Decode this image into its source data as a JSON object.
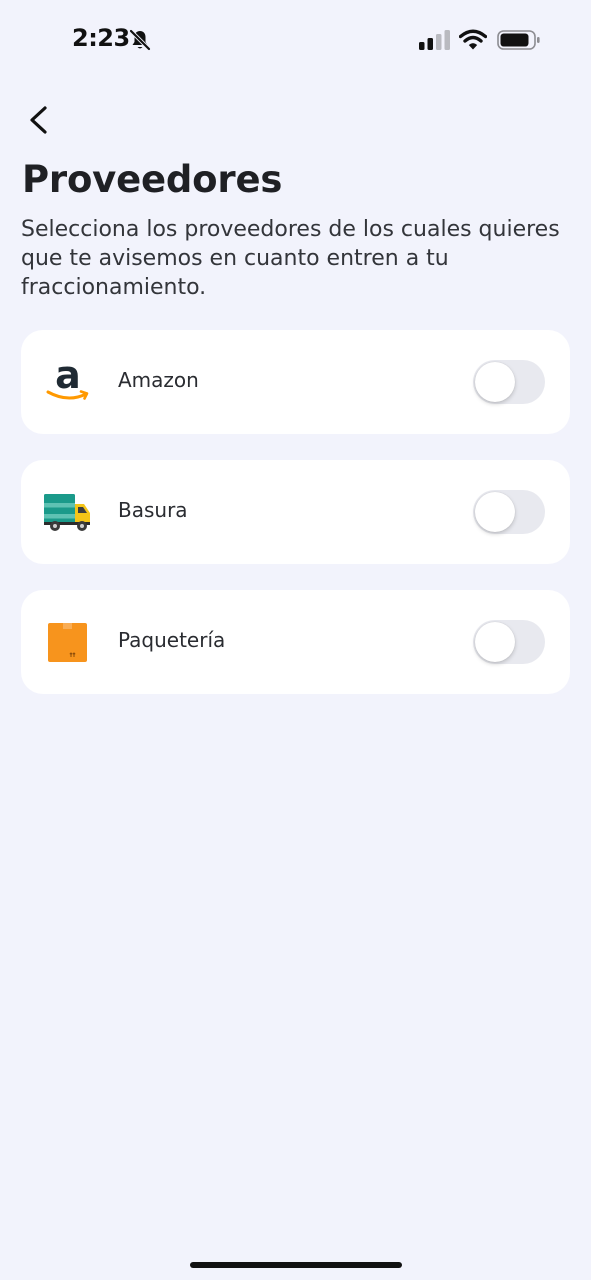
{
  "status_bar": {
    "time": "2:23",
    "icons": [
      "bell-slash-icon",
      "cellular-signal-icon",
      "wifi-icon",
      "battery-icon"
    ]
  },
  "header": {
    "back_icon": "chevron-left-icon",
    "title": "Proveedores",
    "description": "Selecciona los proveedores de los cuales quieres que te avisemos en cuanto entren a tu fraccionamiento."
  },
  "providers": [
    {
      "label": "Amazon",
      "icon": "amazon-logo-icon",
      "enabled": false
    },
    {
      "label": "Basura",
      "icon": "garbage-truck-icon",
      "enabled": false
    },
    {
      "label": "Paquetería",
      "icon": "package-box-icon",
      "enabled": false
    }
  ],
  "colors": {
    "background": "#f2f3fc",
    "card": "#ffffff",
    "toggle_off": "#e8e9ef",
    "amazon_orange": "#ff9900",
    "truck_teal": "#1a9a8a",
    "truck_yellow": "#f5c518",
    "box_orange": "#f7941d"
  }
}
